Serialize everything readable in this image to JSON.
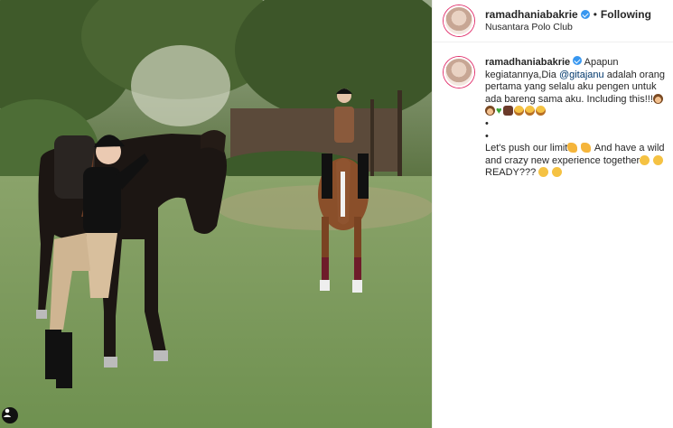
{
  "post": {
    "username": "ramadhaniabakrie",
    "follow_status": "Following",
    "separator": "•",
    "location": "Nusantara Polo Club",
    "caption": {
      "line1_prefix": "Apapun kegiatannya,Dia",
      "mention": "@gitajanu",
      "line1_suffix": "adalah orang pertama yang selalu aku pengen untuk ada bareng sama aku. Including this!!!",
      "bullet1": "•",
      "bullet2": "•",
      "line2_prefix": "Let's push our limit",
      "line2_mid": "And have a wild and crazy new experience together",
      "line3": "READY???"
    }
  },
  "colors": {
    "accent_link": "#00376b",
    "verified_badge": "#3897f0",
    "text": "#262626",
    "border": "#efefef"
  },
  "icons": {
    "verified": "verified-badge-icon",
    "tag": "user-tag-icon"
  }
}
